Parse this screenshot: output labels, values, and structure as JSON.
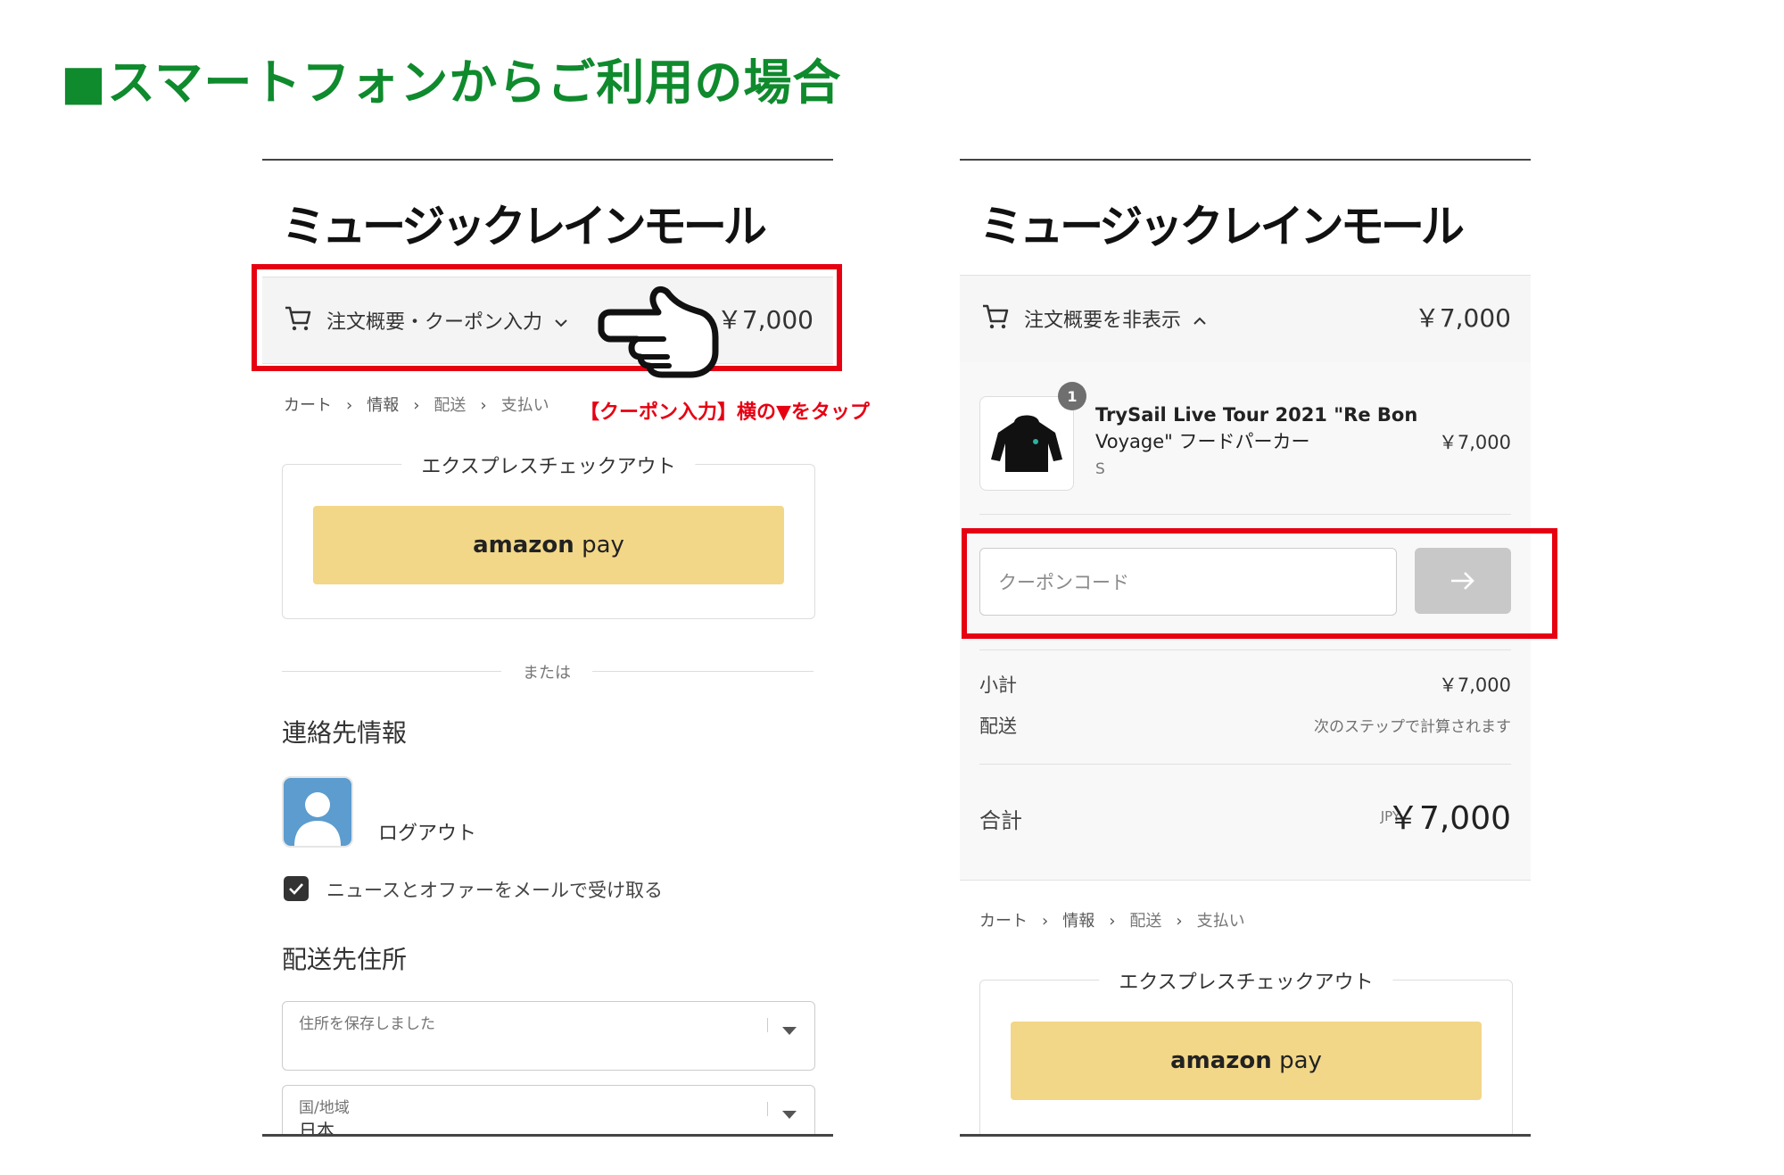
{
  "heading": "■スマートフォンからご利用の場合",
  "store_logo": "ミュージックレインモール",
  "annotation": "【クーポン入力】横の▼をタップ",
  "left_screen": {
    "summary_toggle": "注文概要・クーポン入力",
    "total": "￥7,000",
    "breadcrumb": [
      "カート",
      "情報",
      "配送",
      "支払い"
    ],
    "express_checkout": "エクスプレスチェックアウト",
    "amazon_pay": {
      "brand": "amazon",
      "suffix": "pay"
    },
    "or": "または",
    "contact_title": "連絡先情報",
    "logout": "ログアウト",
    "newsletter": "ニュースとオファーをメールで受け取る",
    "newsletter_checked": true,
    "shipping_title": "配送先住所",
    "saved_address_label": "住所を保存しました",
    "country_label": "国/地域",
    "country_value": "日本"
  },
  "right_screen": {
    "summary_toggle": "注文概要を非表示",
    "total": "￥7,000",
    "item": {
      "qty": "1",
      "title_line1": "TrySail Live Tour 2021 \"Re Bon",
      "title_line2": "Voyage\" フードパーカー",
      "variant": "S",
      "price": "￥7,000"
    },
    "coupon_placeholder": "クーポンコード",
    "apply_icon": "arrow-right-icon",
    "subtotal_label": "小計",
    "subtotal_value": "￥7,000",
    "shipping_label": "配送",
    "shipping_value": "次のステップで計算されます",
    "total_label": "合計",
    "currency": "JPY",
    "grand_total": "￥7,000",
    "breadcrumb": [
      "カート",
      "情報",
      "配送",
      "支払い"
    ],
    "express_checkout": "エクスプレスチェックアウト",
    "amazon_pay": {
      "brand": "amazon",
      "suffix": "pay"
    }
  },
  "colors": {
    "heading_green": "#0f8a2d",
    "highlight_red": "#e60012",
    "amazon_yellow": "#f2d788"
  }
}
